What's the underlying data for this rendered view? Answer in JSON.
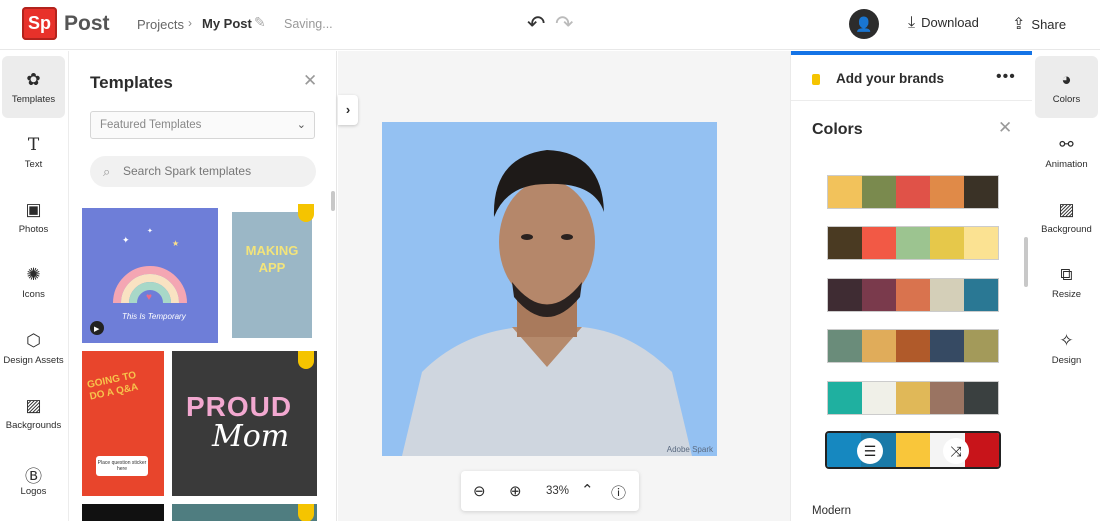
{
  "header": {
    "logo_text": "Sp",
    "app_name": "Post",
    "breadcrumb_projects": "Projects",
    "breadcrumb_sep": "›",
    "doc_name": "My Post",
    "status": "Saving...",
    "download_label": "Download",
    "share_label": "Share"
  },
  "left_nav": [
    {
      "label": "Templates",
      "icon": "templates-icon",
      "active": true
    },
    {
      "label": "Text",
      "icon": "text-icon"
    },
    {
      "label": "Photos",
      "icon": "photos-icon"
    },
    {
      "label": "Icons",
      "icon": "icons-icon"
    },
    {
      "label": "Design Assets",
      "icon": "design-assets-icon"
    },
    {
      "label": "Backgrounds",
      "icon": "backgrounds-icon"
    },
    {
      "label": "Logos",
      "icon": "logos-icon"
    }
  ],
  "templates_panel": {
    "title": "Templates",
    "filter_value": "Featured Templates",
    "search_placeholder": "Search Spark templates",
    "thumb_texts": {
      "t1_caption": "This Is Temporary",
      "t2_text": "MAKING APP",
      "t3_text": "GOING TO DO A Q&A",
      "t3_sticker": "Place question sticker here",
      "t4_line1": "PROUD",
      "t4_line2": "Mom"
    }
  },
  "canvas": {
    "watermark": "Adobe Spark",
    "zoom_value": "33%"
  },
  "right_panel": {
    "brand_label": "Add your brands",
    "colors_title": "Colors",
    "section_label": "Modern",
    "palettes": [
      [
        "#f2c25b",
        "#7a8a4e",
        "#e05248",
        "#e08a48",
        "#3a3226"
      ],
      [
        "#4a3a22",
        "#f25945",
        "#9cc490",
        "#e6c84a",
        "#fbe292"
      ],
      [
        "#3f2c33",
        "#7a3a4c",
        "#d9734e",
        "#d4cfb8",
        "#2a7894"
      ],
      [
        "#6a8c7a",
        "#e0ac5a",
        "#b05a2a",
        "#364a63",
        "#a39a5a"
      ],
      [
        "#1fb0a0",
        "#f0f0e8",
        "#e0b858",
        "#9a7462",
        "#3a4040"
      ],
      [
        "#1688c0",
        "#1a7aa8",
        "#f9c63a",
        "#f4f4f4",
        "#c8141a"
      ]
    ]
  },
  "right_nav": [
    {
      "label": "Colors",
      "icon": "colors-icon",
      "active": true
    },
    {
      "label": "Animation",
      "icon": "animation-icon"
    },
    {
      "label": "Background",
      "icon": "background-icon"
    },
    {
      "label": "Resize",
      "icon": "resize-icon"
    },
    {
      "label": "Design",
      "icon": "design-icon"
    }
  ]
}
